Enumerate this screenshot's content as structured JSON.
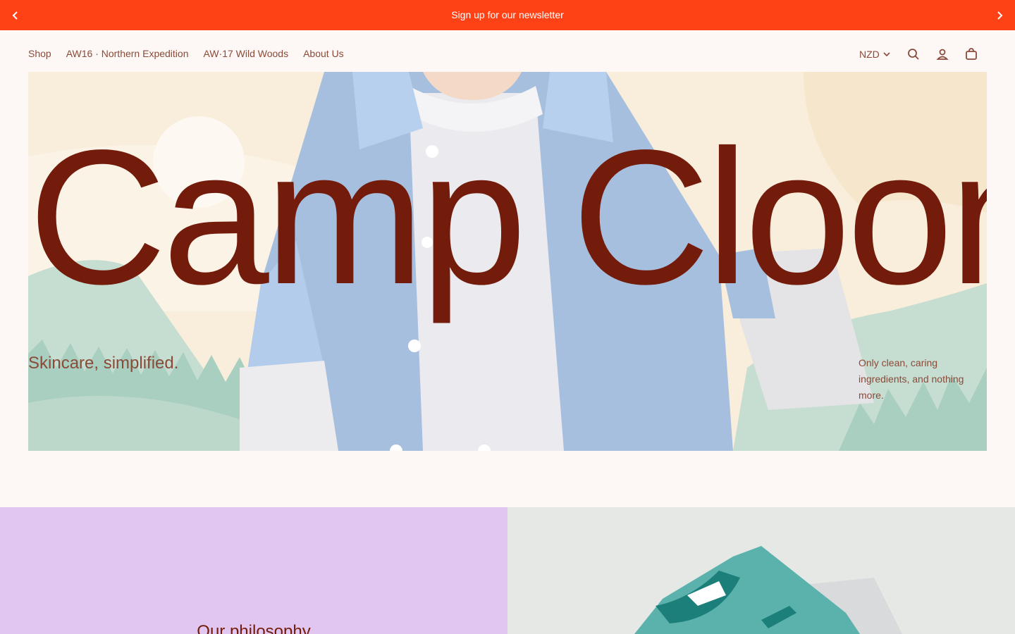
{
  "announcement": {
    "text": "Sign up for our newsletter",
    "prev_icon": "chevron-left-icon",
    "next_icon": "chevron-right-icon"
  },
  "nav": {
    "items": [
      "Shop",
      "AW16 · Northern Expedition",
      "AW·17 Wild Woods",
      "About Us"
    ]
  },
  "header_right": {
    "currency": "NZD",
    "icons": [
      "chevron-down-icon",
      "search-icon",
      "account-icon",
      "cart-icon"
    ]
  },
  "hero": {
    "title": "Camp Cloon",
    "subtitle": "Skincare, simplified.",
    "note": "Only clean, caring ingredients, and nothing more."
  },
  "philosophy": {
    "heading": "Our philosophy"
  },
  "colors": {
    "announcement_bg": "#ff4116",
    "page_bg": "#fdf8f5",
    "brand_text": "#731c0c",
    "philosophy_bg": "#e1c6f1",
    "right_panel_bg": "#e6e8e6"
  }
}
